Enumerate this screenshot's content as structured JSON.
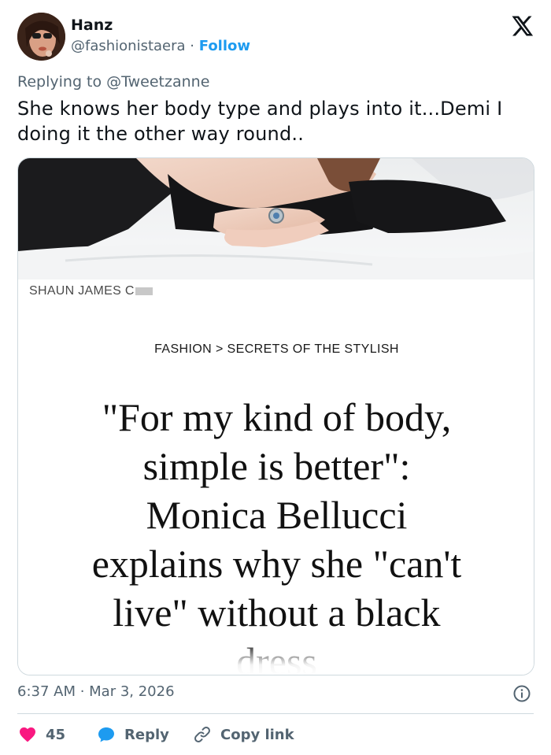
{
  "author": {
    "name": "Hanz",
    "handle": "@fashionistaera",
    "separator": "·",
    "follow_label": "Follow"
  },
  "reply_to": {
    "prefix": "Replying to",
    "mention": "@Tweetzanne"
  },
  "tweet": {
    "text_line1": "She knows her body type and plays into it...Demi I",
    "text_line2": "doing it the other way round.."
  },
  "media": {
    "byline": "SHAUN JAMES C",
    "breadcrumb": "FASHION > SECRETS OF THE STYLISH",
    "headline_lines": [
      "\"For my kind of body,",
      "simple is better\":",
      "Monica Bellucci",
      "explains why she \"can't",
      "live\" without a black",
      "dress"
    ]
  },
  "meta": {
    "timestamp": "6:37 AM · Mar 3, 2026"
  },
  "actions": {
    "likes_count": "45",
    "reply_label": "Reply",
    "copy_label": "Copy link"
  },
  "colors": {
    "accent": "#1d9bf0",
    "like": "#f91880",
    "muted": "#536471",
    "text": "#0f1419",
    "border": "#cfd9de"
  },
  "icons": [
    "x-logo-icon",
    "info-icon",
    "heart-icon",
    "reply-bubble-icon",
    "link-icon"
  ]
}
